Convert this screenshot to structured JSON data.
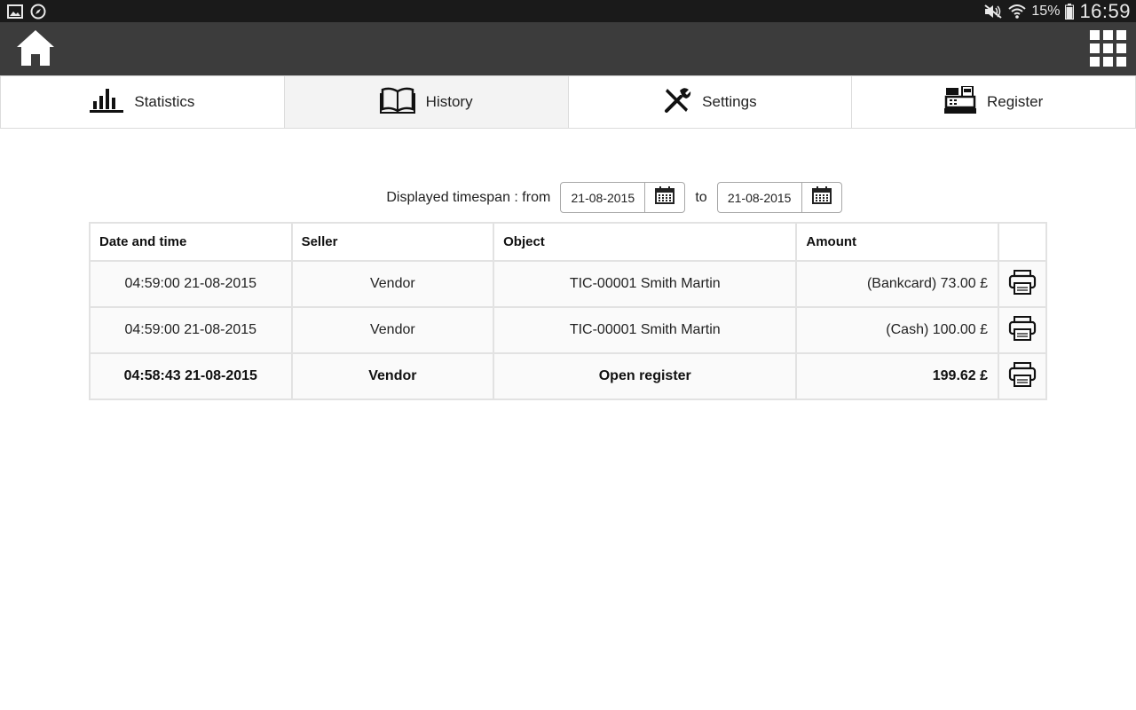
{
  "status_bar": {
    "battery_percent": "15%",
    "time": "16:59",
    "icons": [
      "image-icon",
      "compass-icon",
      "mute-icon",
      "wifi-icon",
      "battery-icon"
    ]
  },
  "app_bar": {
    "left_icon": "home-icon",
    "right_icon": "apps-grid-icon"
  },
  "tabs": [
    {
      "label": "Statistics",
      "icon": "bar-chart-icon",
      "active": false
    },
    {
      "label": "History",
      "icon": "book-icon",
      "active": true
    },
    {
      "label": "Settings",
      "icon": "tools-icon",
      "active": false
    },
    {
      "label": "Register",
      "icon": "cash-register-icon",
      "active": false
    }
  ],
  "timespan": {
    "label": "Displayed timespan : from",
    "from": "21-08-2015",
    "to_label": "to",
    "to": "21-08-2015"
  },
  "table": {
    "headers": [
      "Date and time",
      "Seller",
      "Object",
      "Amount"
    ],
    "rows": [
      {
        "datetime": "04:59:00 21-08-2015",
        "seller": "Vendor",
        "object": "TIC-00001 Smith Martin",
        "amount": "(Bankcard) 73.00 £",
        "bold": false
      },
      {
        "datetime": "04:59:00 21-08-2015",
        "seller": "Vendor",
        "object": "TIC-00001 Smith Martin",
        "amount": "(Cash) 100.00 £",
        "bold": false
      },
      {
        "datetime": "04:58:43 21-08-2015",
        "seller": "Vendor",
        "object": "Open register",
        "amount": "199.62 £",
        "bold": true
      }
    ]
  },
  "colors": {
    "status_bar_bg": "#1a1a1a",
    "app_bar_bg": "#3c3c3c",
    "active_tab_bg": "#f3f3f3",
    "table_border": "#e2e2e2"
  }
}
